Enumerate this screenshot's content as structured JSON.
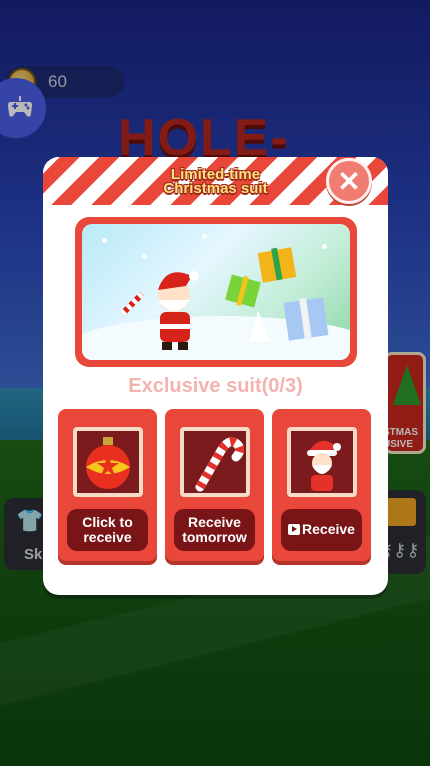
{
  "hud": {
    "coins": "60",
    "game_title": "HOLE-"
  },
  "side_buttons": {
    "skins_label": "Sk",
    "christmas_label": "STMAS\nUSIVE"
  },
  "modal": {
    "title_line1": "Limited-time",
    "title_line2": "Christmas suit",
    "close_label": "✕",
    "progress_text": "Exclusive suit(0/3)",
    "items": [
      {
        "icon": "ornament-ball-icon",
        "button_label": "Click to receive"
      },
      {
        "icon": "candy-cane-icon",
        "button_label": "Receive tomorrow"
      },
      {
        "icon": "santa-figure-icon",
        "button_label": "Receive",
        "button_icon": "video-play-icon"
      }
    ]
  },
  "colors": {
    "modal_red": "#e8473a",
    "button_dark_red": "#7a1517",
    "title_yellow": "#ffe07a",
    "progress_pink": "#f3b3ae"
  }
}
